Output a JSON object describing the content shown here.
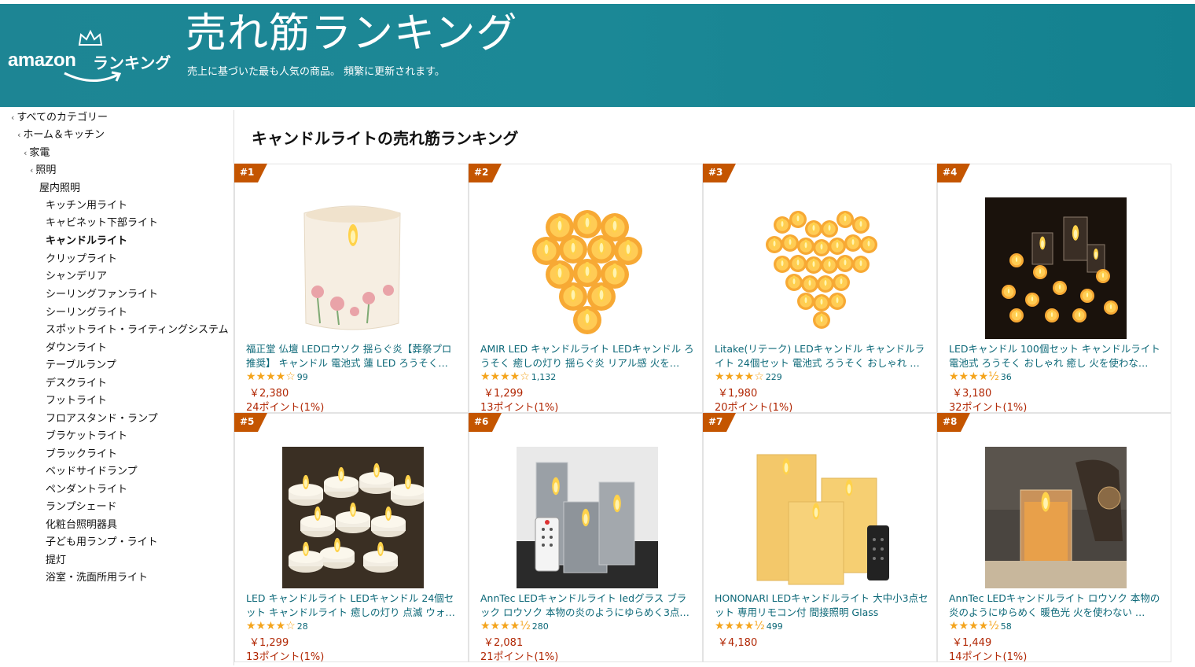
{
  "header": {
    "logo_amazon": "amazon",
    "logo_rank": "ランキング",
    "title": "売れ筋ランキング",
    "subtitle": "売上に基づいた最も人気の商品。 頻繁に更新されます。",
    "bg_color": "#1a8593"
  },
  "sidebar": {
    "items": [
      {
        "label": "すべてのカテゴリー",
        "chevron": "‹"
      },
      {
        "label": "ホーム＆キッチン",
        "chevron": "‹"
      },
      {
        "label": "家電",
        "chevron": "‹"
      },
      {
        "label": "照明",
        "chevron": "‹"
      },
      {
        "label": "屋内照明",
        "chevron": ""
      },
      {
        "label": "キッチン用ライト",
        "chevron": ""
      },
      {
        "label": "キャビネット下部ライト",
        "chevron": ""
      },
      {
        "label": "キャンドルライト",
        "chevron": "",
        "selected": true
      },
      {
        "label": "クリップライト",
        "chevron": ""
      },
      {
        "label": "シャンデリア",
        "chevron": ""
      },
      {
        "label": "シーリングファンライト",
        "chevron": ""
      },
      {
        "label": "シーリングライト",
        "chevron": ""
      },
      {
        "label": "スポットライト・ライティングシステム",
        "chevron": ""
      },
      {
        "label": "ダウンライト",
        "chevron": ""
      },
      {
        "label": "テーブルランプ",
        "chevron": ""
      },
      {
        "label": "デスクライト",
        "chevron": ""
      },
      {
        "label": "フットライト",
        "chevron": ""
      },
      {
        "label": "フロアスタンド・ランプ",
        "chevron": ""
      },
      {
        "label": "ブラケットライト",
        "chevron": ""
      },
      {
        "label": "ブラックライト",
        "chevron": ""
      },
      {
        "label": "ベッドサイドランプ",
        "chevron": ""
      },
      {
        "label": "ペンダントライト",
        "chevron": ""
      },
      {
        "label": "ランプシェード",
        "chevron": ""
      },
      {
        "label": "化粧台照明器具",
        "chevron": ""
      },
      {
        "label": "子ども用ランプ・ライト",
        "chevron": ""
      },
      {
        "label": "提灯",
        "chevron": ""
      },
      {
        "label": "浴室・洗面所用ライト",
        "chevron": ""
      }
    ]
  },
  "main": {
    "heading": "キャンドルライトの売れ筋ランキング",
    "badge_color": "#c45500",
    "products": [
      {
        "rank": "#1",
        "title": "福正堂 仏壇 LEDロウソク 揺らぐ炎【葬祭プロ推奨】 キャンドル 電池式 蓮 LED ろうそく…",
        "stars": "★★★★☆",
        "reviews": "99",
        "price": "￥2,380",
        "points": "24ポイント(1%)",
        "image": "lotus-pillar-candle"
      },
      {
        "rank": "#2",
        "title": "AMIR LED キャンドルライト LEDキャンドル ろうそく 癒しの灯り 揺らぐ炎 リアル感 火を…",
        "stars": "★★★★☆",
        "reviews": "1,132",
        "price": "￥1,299",
        "points": "13ポイント(1%)",
        "image": "tealight-cluster"
      },
      {
        "rank": "#3",
        "title": "Litake(リテーク) LEDキャンドル キャンドルライト 24個セット 電池式 ろうそく おしゃれ …",
        "stars": "★★★★☆",
        "reviews": "229",
        "price": "￥1,980",
        "points": "20ポイント(1%)",
        "image": "tealight-heart"
      },
      {
        "rank": "#4",
        "title": "LEDキャンドル 100個セット キャンドルライト電池式 ろうそく おしゃれ 癒し 火を使わな…",
        "stars": "★★★★½",
        "reviews": "36",
        "price": "￥3,180",
        "points": "32ポイント(1%)",
        "image": "dark-crystal-candles"
      },
      {
        "rank": "#5",
        "title": "LED キャンドルライト LEDキャンドル 24個セット キャンドルライト 癒しの灯り 点滅 ウォ…",
        "stars": "★★★★☆",
        "reviews": "28",
        "price": "￥1,299",
        "points": "13ポイント(1%)",
        "image": "tealights-table"
      },
      {
        "rank": "#6",
        "title": "AnnTec LEDキャンドルライト ledグラス ブラック ロウソク 本物の炎のようにゆらめく3点…",
        "stars": "★★★★½",
        "reviews": "280",
        "price": "￥2,081",
        "points": "21ポイント(1%)",
        "image": "glass-candles-remote"
      },
      {
        "rank": "#7",
        "title": "HONONARI LEDキャンドルライト 大中小3点セット 専用リモコン付 間接照明 Glass",
        "stars": "★★★★½",
        "reviews": "499",
        "price": "￥4,180",
        "points": "",
        "image": "pillar-candles-remote"
      },
      {
        "rank": "#8",
        "title": "AnnTec LEDキャンドルライト ロウソク 本物の炎のようにゆらめく 暖色光 火を使わない …",
        "stars": "★★★★½",
        "reviews": "58",
        "price": "￥1,449",
        "points": "14ポイント(1%)",
        "image": "glass-candle-phone"
      }
    ]
  }
}
